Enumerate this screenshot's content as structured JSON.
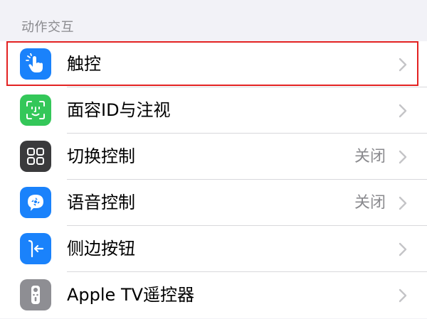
{
  "section": {
    "title": "动作交互"
  },
  "items": [
    {
      "label": "触控",
      "value": "",
      "icon": "hand-touch-icon",
      "color": "#1a82fb"
    },
    {
      "label": "面容ID与注视",
      "value": "",
      "icon": "face-id-icon",
      "color": "#34c759"
    },
    {
      "label": "切换控制",
      "value": "关闭",
      "icon": "switch-control-icon",
      "color": "#3a3a3c"
    },
    {
      "label": "语音控制",
      "value": "关闭",
      "icon": "voice-control-icon",
      "color": "#1a82fb"
    },
    {
      "label": "侧边按钮",
      "value": "",
      "icon": "side-button-icon",
      "color": "#1a82fb"
    },
    {
      "label": "Apple TV遥控器",
      "value": "",
      "icon": "tv-remote-icon",
      "color": "#8e8e93"
    }
  ],
  "colors": {
    "highlight": "#e32222",
    "chevron": "#c4c4c7"
  }
}
